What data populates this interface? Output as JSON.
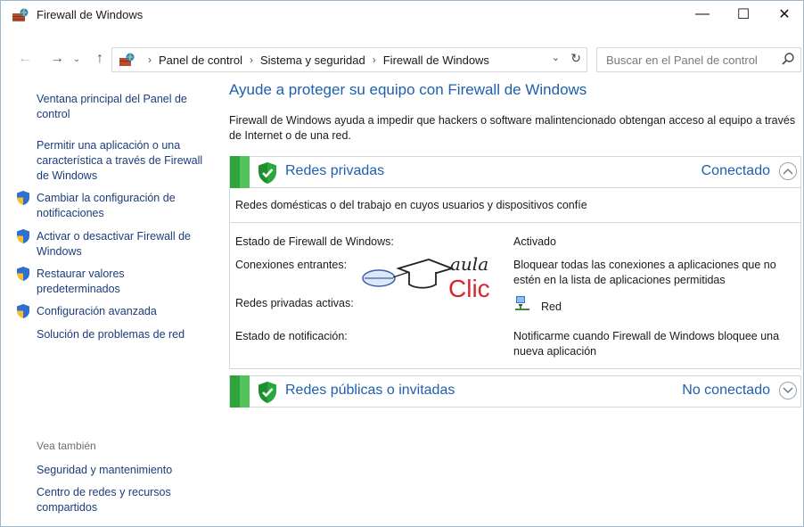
{
  "window": {
    "title": "Firewall de Windows",
    "controls": {
      "minimize": "—",
      "maximize": "☐",
      "close": "✕"
    }
  },
  "nav": {
    "back": "←",
    "forward": "→",
    "recent": "⌄",
    "up": "↑",
    "breadcrumbs": [
      "Panel de control",
      "Sistema y seguridad",
      "Firewall de Windows"
    ],
    "separator": "›",
    "search_placeholder": "Buscar en el Panel de control"
  },
  "sidebar": {
    "links": [
      {
        "label": "Ventana principal del Panel de control",
        "shield": false
      },
      {
        "label": "Permitir una aplicación o una característica a través de Firewall de Windows",
        "shield": false
      },
      {
        "label": "Cambiar la configuración de notificaciones",
        "shield": true
      },
      {
        "label": "Activar o desactivar Firewall de Windows",
        "shield": true
      },
      {
        "label": "Restaurar valores predeterminados",
        "shield": true
      },
      {
        "label": "Configuración avanzada",
        "shield": true
      },
      {
        "label": "Solución de problemas de red",
        "shield": false
      }
    ],
    "see_also_heading": "Vea también",
    "see_also": [
      "Seguridad y mantenimiento",
      "Centro de redes y recursos compartidos"
    ]
  },
  "main": {
    "title": "Ayude a proteger su equipo con Firewall de Windows",
    "description": "Firewall de Windows ayuda a impedir que hackers o software malintencionado obtengan acceso al equipo a través de Internet o de una red.",
    "private": {
      "title": "Redes privadas",
      "status": "Conectado",
      "subtitle": "Redes domésticas o del trabajo en cuyos usuarios y dispositivos confíe",
      "rows": {
        "firewall_state_label": "Estado de Firewall de Windows:",
        "firewall_state_value": "Activado",
        "incoming_label": "Conexiones entrantes:",
        "incoming_value": "Bloquear todas las conexiones a aplicaciones que no estén en la lista de aplicaciones permitidas",
        "active_label": "Redes privadas activas:",
        "active_value": "Red",
        "notify_label": "Estado de notificación:",
        "notify_value": "Notificarme cuando Firewall de Windows bloquee una nueva aplicación"
      }
    },
    "public": {
      "title": "Redes públicas o invitadas",
      "status": "No conectado"
    }
  },
  "watermark": {
    "line1": "aula",
    "line2": "Clic"
  },
  "colors": {
    "link": "#1c3d7a",
    "heading": "#1e5fae",
    "green": "#2ea43a",
    "watermark_red": "#d9262b"
  }
}
